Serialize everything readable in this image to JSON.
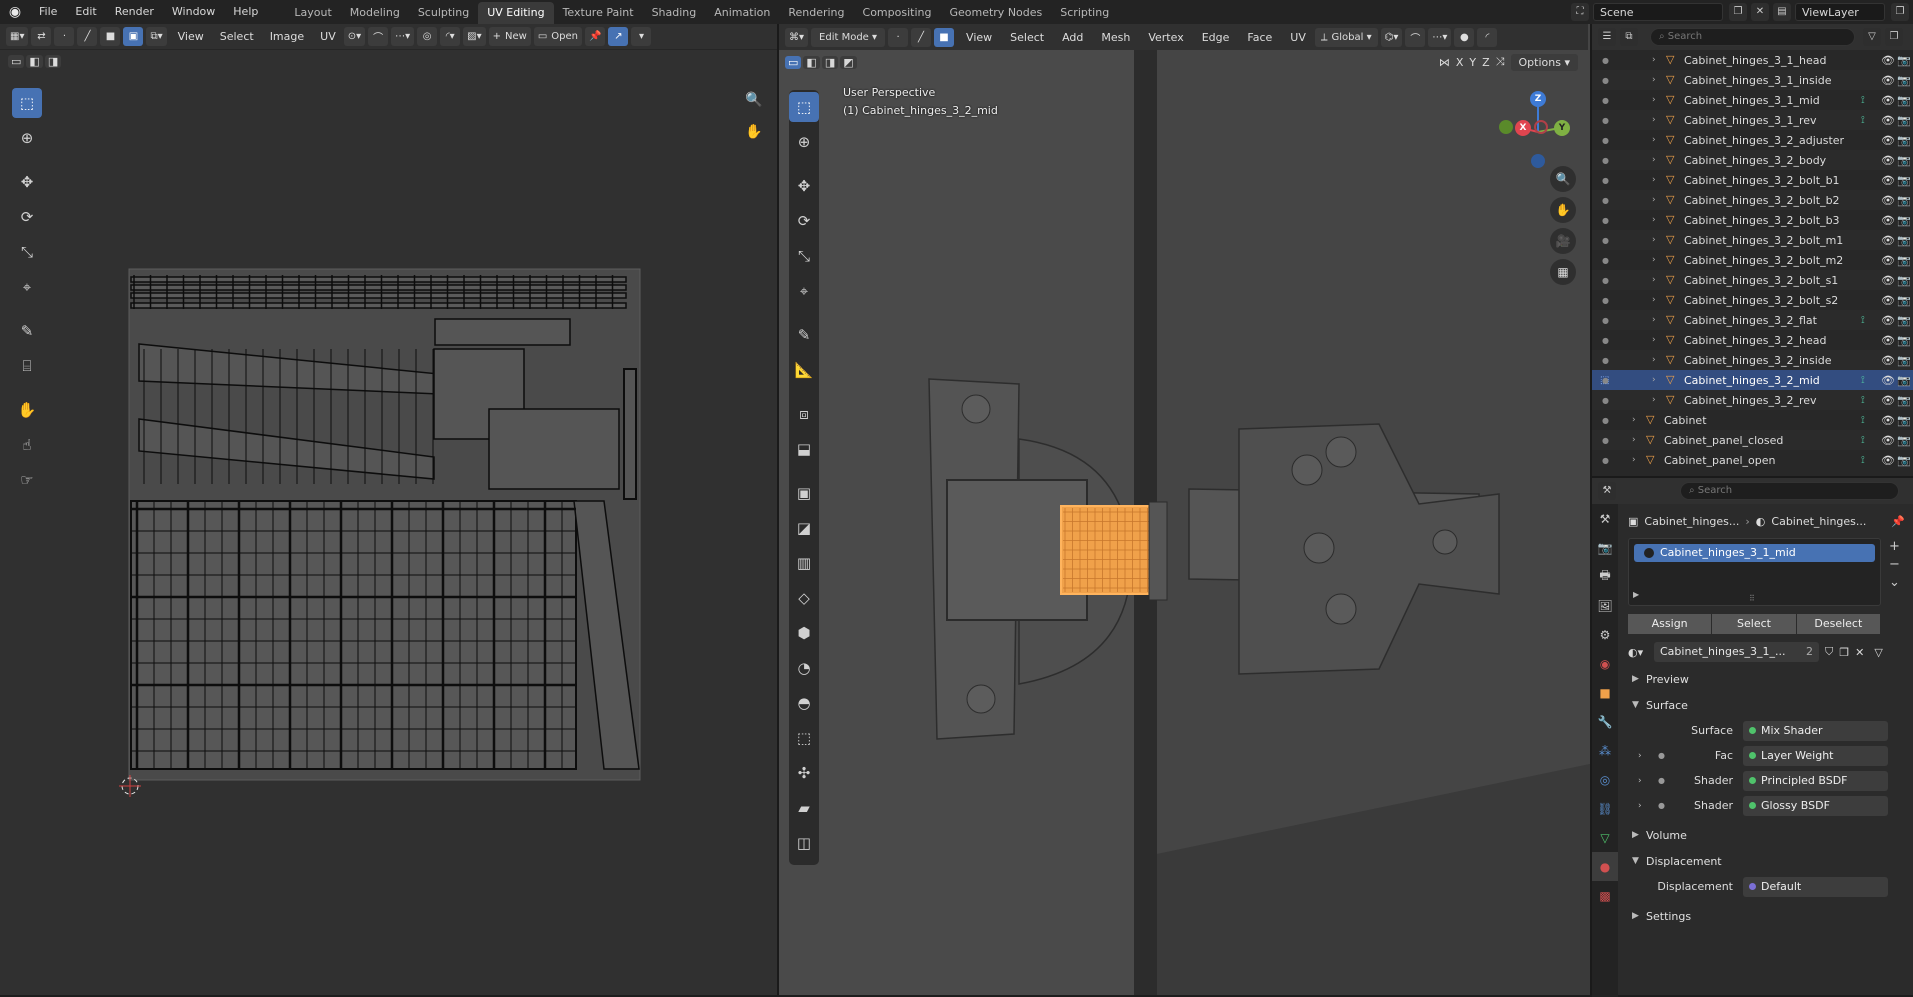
{
  "topbar": {
    "menus": [
      "File",
      "Edit",
      "Render",
      "Window",
      "Help"
    ],
    "workspaces": [
      "Layout",
      "Modeling",
      "Sculpting",
      "UV Editing",
      "Texture Paint",
      "Shading",
      "Animation",
      "Rendering",
      "Compositing",
      "Geometry Nodes",
      "Scripting"
    ],
    "active_workspace": "UV Editing",
    "scene": "Scene",
    "view_layer": "ViewLayer"
  },
  "uv_editor": {
    "menus": [
      "View",
      "Select",
      "Image",
      "UV"
    ],
    "new_label": "New",
    "open_label": "Open"
  },
  "viewport": {
    "mode": "Edit Mode",
    "menus": [
      "View",
      "Select",
      "Add",
      "Mesh",
      "Vertex",
      "Edge",
      "Face",
      "UV"
    ],
    "orientation": "Global",
    "axes": [
      "X",
      "Y",
      "Z"
    ],
    "options_label": "Options",
    "info_line1": "User Perspective",
    "info_line2": "(1) Cabinet_hinges_3_2_mid",
    "gizmo": {
      "x": "X",
      "y": "Y",
      "z": "Z"
    }
  },
  "outliner": {
    "search_placeholder": "Search",
    "rows": [
      {
        "label": "Cabinet_hinges_3_1_head",
        "indent": 2,
        "mod": false,
        "selected": false
      },
      {
        "label": "Cabinet_hinges_3_1_inside",
        "indent": 2,
        "mod": false,
        "selected": false
      },
      {
        "label": "Cabinet_hinges_3_1_mid",
        "indent": 2,
        "mod": true,
        "selected": false
      },
      {
        "label": "Cabinet_hinges_3_1_rev",
        "indent": 2,
        "mod": true,
        "selected": false
      },
      {
        "label": "Cabinet_hinges_3_2_adjuster",
        "indent": 2,
        "mod": false,
        "selected": false
      },
      {
        "label": "Cabinet_hinges_3_2_body",
        "indent": 2,
        "mod": false,
        "selected": false
      },
      {
        "label": "Cabinet_hinges_3_2_bolt_b1",
        "indent": 2,
        "mod": false,
        "selected": false
      },
      {
        "label": "Cabinet_hinges_3_2_bolt_b2",
        "indent": 2,
        "mod": false,
        "selected": false
      },
      {
        "label": "Cabinet_hinges_3_2_bolt_b3",
        "indent": 2,
        "mod": false,
        "selected": false
      },
      {
        "label": "Cabinet_hinges_3_2_bolt_m1",
        "indent": 2,
        "mod": false,
        "selected": false
      },
      {
        "label": "Cabinet_hinges_3_2_bolt_m2",
        "indent": 2,
        "mod": false,
        "selected": false
      },
      {
        "label": "Cabinet_hinges_3_2_bolt_s1",
        "indent": 2,
        "mod": false,
        "selected": false
      },
      {
        "label": "Cabinet_hinges_3_2_bolt_s2",
        "indent": 2,
        "mod": false,
        "selected": false
      },
      {
        "label": "Cabinet_hinges_3_2_flat",
        "indent": 2,
        "mod": true,
        "selected": false
      },
      {
        "label": "Cabinet_hinges_3_2_head",
        "indent": 2,
        "mod": false,
        "selected": false
      },
      {
        "label": "Cabinet_hinges_3_2_inside",
        "indent": 2,
        "mod": false,
        "selected": false
      },
      {
        "label": "Cabinet_hinges_3_2_mid",
        "indent": 2,
        "mod": true,
        "selected": true
      },
      {
        "label": "Cabinet_hinges_3_2_rev",
        "indent": 2,
        "mod": true,
        "selected": false
      },
      {
        "label": "Cabinet",
        "indent": 1,
        "mod": true,
        "selected": false
      },
      {
        "label": "Cabinet_panel_closed",
        "indent": 1,
        "mod": true,
        "selected": false
      },
      {
        "label": "Cabinet_panel_open",
        "indent": 1,
        "mod": true,
        "selected": false
      }
    ]
  },
  "properties": {
    "search_placeholder": "Search",
    "breadcrumb_object": "Cabinet_hinges...",
    "breadcrumb_material": "Cabinet_hinges...",
    "material_slot": "Cabinet_hinges_3_1_mid",
    "assign_label": "Assign",
    "select_label": "Select",
    "deselect_label": "Deselect",
    "material_name": "Cabinet_hinges_3_1_...",
    "material_users": "2",
    "panels": {
      "preview": "Preview",
      "surface": "Surface",
      "volume": "Volume",
      "displacement": "Displacement",
      "settings": "Settings"
    },
    "surface_rows": [
      {
        "label": "Surface",
        "value": "Mix Shader",
        "expand": false
      },
      {
        "label": "Fac",
        "value": "Layer Weight",
        "expand": true
      },
      {
        "label": "Shader",
        "value": "Principled BSDF",
        "expand": true
      },
      {
        "label": "Shader",
        "value": "Glossy BSDF",
        "expand": true
      }
    ],
    "displacement_row": {
      "label": "Displacement",
      "value": "Default"
    }
  },
  "colors": {
    "accent": "#4772b3",
    "selection_orange": "#f0a14a",
    "x_axis": "#e0454f",
    "y_axis": "#7fb043",
    "z_axis": "#3e7bd6"
  }
}
